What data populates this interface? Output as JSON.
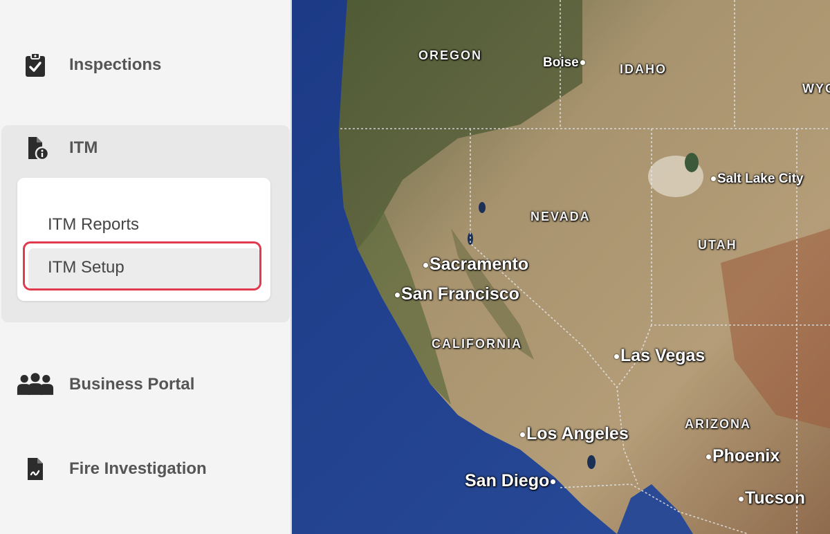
{
  "sidebar": {
    "items": [
      {
        "label": "Inspections",
        "icon": "clipboard-check-icon"
      },
      {
        "label": "ITM",
        "icon": "file-info-icon"
      },
      {
        "label": "Business Portal",
        "icon": "users-group-icon"
      },
      {
        "label": "Fire Investigation",
        "icon": "file-signature-icon"
      }
    ],
    "itm_submenu": [
      {
        "label": "ITM Reports"
      },
      {
        "label": "ITM Setup",
        "highlighted": true
      }
    ]
  },
  "map": {
    "states": [
      "OREGON",
      "IDAHO",
      "WYO",
      "NEVADA",
      "UTAH",
      "CALIFORNIA",
      "ARIZONA"
    ],
    "cities": [
      "Boise",
      "Salt Lake City",
      "Sacramento",
      "San Francisco",
      "Las Vegas",
      "Los Angeles",
      "San Diego",
      "Phoenix",
      "Tucson"
    ]
  },
  "colors": {
    "highlight": "#e03a4e",
    "ocean": "#1f3d8a",
    "land": "#a89470"
  }
}
